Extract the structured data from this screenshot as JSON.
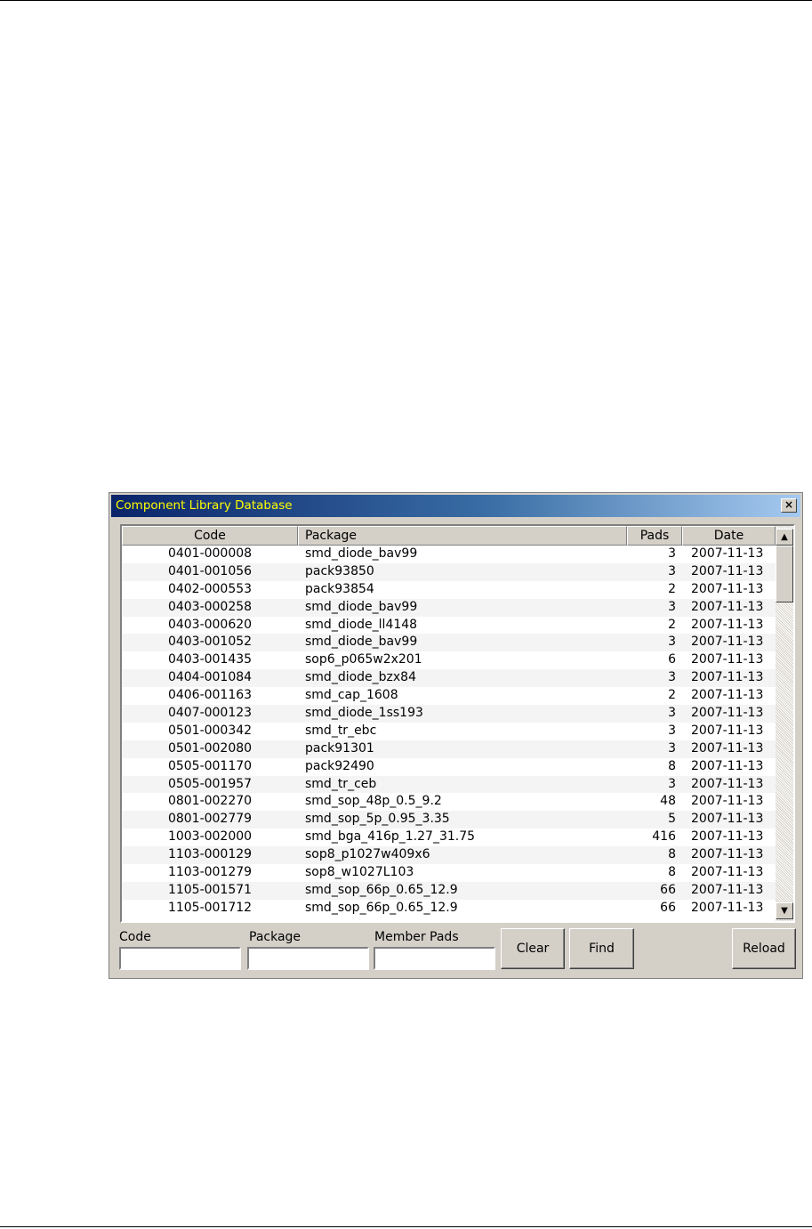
{
  "window": {
    "title": "Component Library Database",
    "close_glyph": "×"
  },
  "table": {
    "columns": [
      "Code",
      "Package",
      "Pads",
      "Date"
    ],
    "rows": [
      [
        "0401-000008",
        "smd_diode_bav99",
        "3",
        "2007-11-13"
      ],
      [
        "0401-001056",
        "pack93850",
        "3",
        "2007-11-13"
      ],
      [
        "0402-000553",
        "pack93854",
        "2",
        "2007-11-13"
      ],
      [
        "0403-000258",
        "smd_diode_bav99",
        "3",
        "2007-11-13"
      ],
      [
        "0403-000620",
        "smd_diode_ll4148",
        "2",
        "2007-11-13"
      ],
      [
        "0403-001052",
        "smd_diode_bav99",
        "3",
        "2007-11-13"
      ],
      [
        "0403-001435",
        "sop6_p065w2x201",
        "6",
        "2007-11-13"
      ],
      [
        "0404-001084",
        "smd_diode_bzx84",
        "3",
        "2007-11-13"
      ],
      [
        "0406-001163",
        "smd_cap_1608",
        "2",
        "2007-11-13"
      ],
      [
        "0407-000123",
        "smd_diode_1ss193",
        "3",
        "2007-11-13"
      ],
      [
        "0501-000342",
        "smd_tr_ebc",
        "3",
        "2007-11-13"
      ],
      [
        "0501-002080",
        "pack91301",
        "3",
        "2007-11-13"
      ],
      [
        "0505-001170",
        "pack92490",
        "8",
        "2007-11-13"
      ],
      [
        "0505-001957",
        "smd_tr_ceb",
        "3",
        "2007-11-13"
      ],
      [
        "0801-002270",
        "smd_sop_48p_0.5_9.2",
        "48",
        "2007-11-13"
      ],
      [
        "0801-002779",
        "smd_sop_5p_0.95_3.35",
        "5",
        "2007-11-13"
      ],
      [
        "1003-002000",
        "smd_bga_416p_1.27_31.75",
        "416",
        "2007-11-13"
      ],
      [
        "1103-000129",
        "sop8_p1027w409x6",
        "8",
        "2007-11-13"
      ],
      [
        "1103-001279",
        "sop8_w1027L103",
        "8",
        "2007-11-13"
      ],
      [
        "1105-001571",
        "smd_sop_66p_0.65_12.9",
        "66",
        "2007-11-13"
      ],
      [
        "1105-001712",
        "smd_sop_66p_0.65_12.9",
        "66",
        "2007-11-13"
      ]
    ]
  },
  "scrollbar": {
    "up_glyph": "▲",
    "down_glyph": "▼"
  },
  "search": {
    "code_label": "Code",
    "code_value": "",
    "package_label": "Package",
    "package_value": "",
    "member_pads_label": "Member Pads",
    "member_pads_value": ""
  },
  "buttons": {
    "clear": "Clear",
    "find": "Find",
    "reload": "Reload"
  },
  "colors": {
    "title_text": "#ffff00",
    "titlebar_start": "#0a246a",
    "titlebar_end": "#a6caf0",
    "face": "#d4d0c8"
  }
}
